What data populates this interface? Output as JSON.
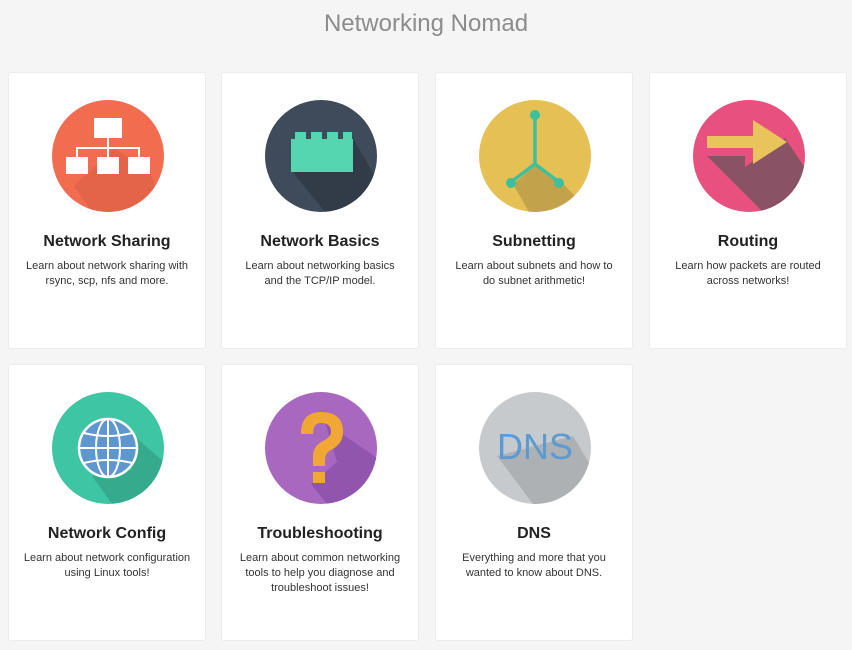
{
  "site": {
    "title": "Networking Nomad"
  },
  "cards": [
    {
      "title": "Network Sharing",
      "description": "Learn about network sharing with rsync, scp, nfs and more.",
      "icon": "network-hierarchy-icon",
      "color": "#f1694f"
    },
    {
      "title": "Network Basics",
      "description": "Learn about networking basics and the TCP/IP model.",
      "icon": "lego-brick-icon",
      "color": "#3f4b5b"
    },
    {
      "title": "Subnetting",
      "description": "Learn about subnets and how to do subnet arithmetic!",
      "icon": "fork-branch-icon",
      "color": "#e4be53"
    },
    {
      "title": "Routing",
      "description": "Learn how packets are routed across networks!",
      "icon": "arrow-right-icon",
      "color": "#e84c7d"
    },
    {
      "title": "Network Config",
      "description": "Learn about network configuration using Linux tools!",
      "icon": "globe-icon",
      "color": "#3dc4a2"
    },
    {
      "title": "Troubleshooting",
      "description": "Learn about common networking tools to help you diagnose and troubleshoot issues!",
      "icon": "question-mark-icon",
      "color": "#a466bf"
    },
    {
      "title": "DNS",
      "description": "Everything and more that you wanted to know about DNS.",
      "icon": "dns-text-icon",
      "color": "#c5c9cd",
      "icon_text": "DNS"
    }
  ]
}
